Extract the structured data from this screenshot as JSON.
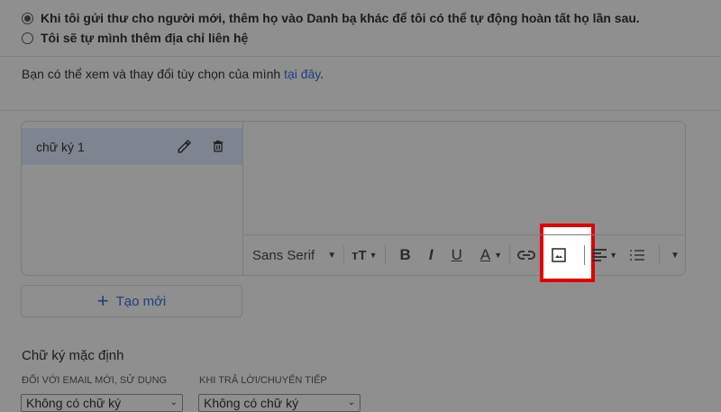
{
  "contacts": {
    "options": [
      {
        "label": "Khi tôi gửi thư cho người mới, thêm họ vào Danh bạ khác để tôi có thể tự động hoàn tất họ lần sau.",
        "selected": true
      },
      {
        "label": "Tôi sẽ tự mình thêm địa chỉ liên hệ",
        "selected": false
      }
    ]
  },
  "prefs": {
    "text": "Bạn có thể xem và thay đổi tùy chọn của mình ",
    "link": "tại đây",
    "end": "."
  },
  "signature": {
    "items": [
      {
        "name": "chữ ký 1"
      }
    ],
    "new_label": "Tạo mới"
  },
  "toolbar": {
    "font": "Sans Serif",
    "bold": "B",
    "italic": "I",
    "underline": "U",
    "color": "A",
    "size": "тT"
  },
  "defaults": {
    "title": "Chữ ký mặc định",
    "new_email_label": "ĐỐI VỚI EMAIL MỚI, SỬ DỤNG",
    "new_email_value": "Không có chữ ký",
    "reply_label": "KHI TRẢ LỜI/CHUYỂN TIẾP",
    "reply_value": "Không có chữ ký"
  },
  "colors": {
    "highlight": "#e00000",
    "link": "#1f3f80"
  }
}
